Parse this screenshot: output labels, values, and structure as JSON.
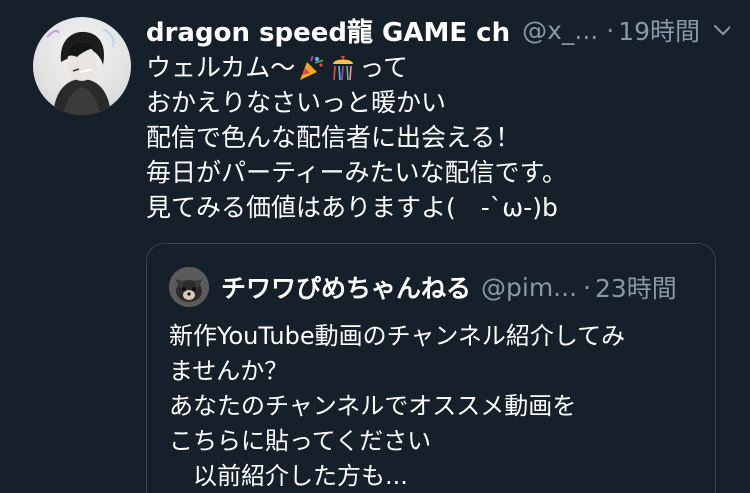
{
  "tweet": {
    "display_name": "dragon speed龍 GAME ch",
    "handle": "@x_...",
    "separator": "·",
    "time": "19時間",
    "caret_icon": "chevron-down-icon",
    "body_line1_prefix": "ウェルカム〜",
    "body_line1_suffix": "って",
    "body_lines": [
      "おかえりなさいっと暖かい",
      "配信で色んな配信者に出会える！",
      "毎日がパーティーみたいな配信です。",
      "見てみる価値はありますよ(　-`ω-)b"
    ],
    "emojis": [
      "party-popper-icon",
      "confetti-ball-icon"
    ]
  },
  "quote": {
    "display_name": "チワワぴめちゃんねる",
    "handle": "@pim...",
    "separator": "·",
    "time": "23時間",
    "body_lines": [
      "新作YouTube動画のチャンネル紹介してみ",
      "ませんか？",
      "あなたのチャンネルでオススメ動画を",
      "こちらに貼ってください",
      "　以前紹介した方も..."
    ]
  },
  "colors": {
    "background": "#15202b",
    "text_primary": "#ffffff",
    "text_secondary": "#8899a6",
    "border": "#38444d"
  }
}
